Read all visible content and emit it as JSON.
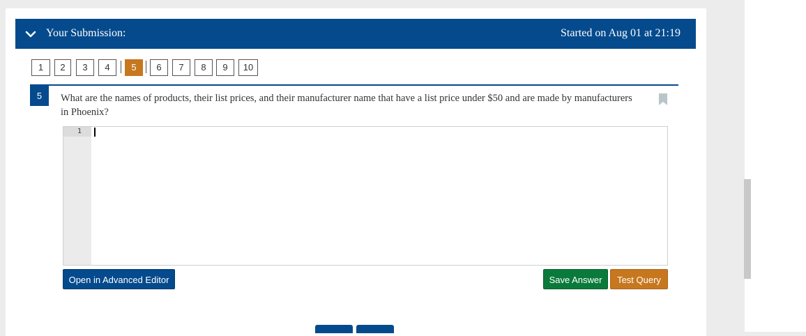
{
  "header": {
    "title": "Your Submission:",
    "started": "Started on Aug 01 at 21:19"
  },
  "pager": {
    "items": [
      "1",
      "2",
      "3",
      "4",
      "5",
      "6",
      "7",
      "8",
      "9",
      "10"
    ],
    "active": "5"
  },
  "question": {
    "number": "5",
    "text": "What are the names of products, their list prices, and their manufacturer name that have a list price under $50 and are made by manufacturers in Phoenix?"
  },
  "editor": {
    "line_numbers": [
      "1"
    ],
    "content": ""
  },
  "buttons": {
    "advanced_editor": "Open in Advanced Editor",
    "save_answer": "Save Answer",
    "test_query": "Test Query"
  },
  "colors": {
    "primary": "#044a8d",
    "accent": "#c7771e",
    "success": "#0a7a3b"
  }
}
